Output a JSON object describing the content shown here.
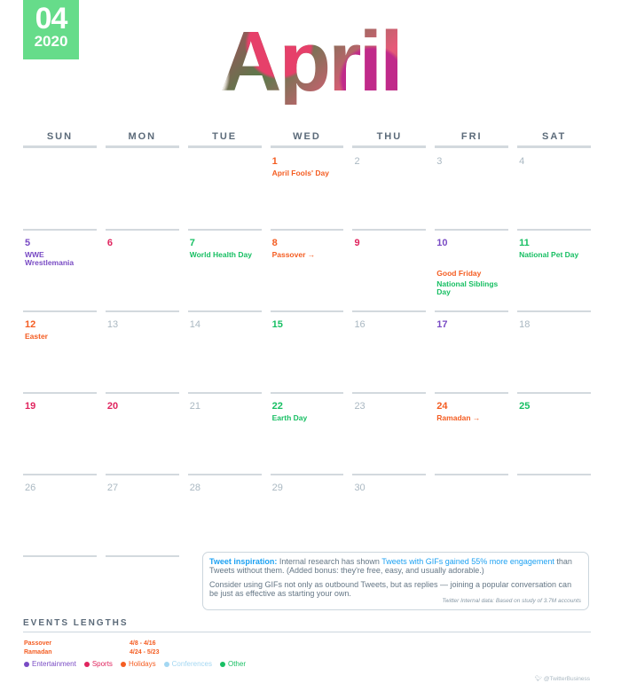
{
  "badge": {
    "month_number": "04",
    "year": "2020",
    "color": "#66dc8a"
  },
  "month_title": "April",
  "weekdays": [
    "SUN",
    "MON",
    "TUE",
    "WED",
    "THU",
    "FRI",
    "SAT"
  ],
  "weeks": [
    [
      {
        "num": "",
        "events": []
      },
      {
        "num": "",
        "events": []
      },
      {
        "num": "",
        "events": []
      },
      {
        "num": "1",
        "cat": "hol",
        "events": [
          {
            "label": "April Fools' Day",
            "cat": "hol"
          }
        ]
      },
      {
        "num": "2",
        "cat": "muted",
        "events": []
      },
      {
        "num": "3",
        "cat": "muted",
        "events": []
      },
      {
        "num": "4",
        "cat": "muted",
        "events": []
      }
    ],
    [
      {
        "num": "5",
        "cat": "ent",
        "events": [
          {
            "label": "WWE Wrestlemania",
            "cat": "ent"
          }
        ]
      },
      {
        "num": "6",
        "cat": "sport",
        "events": []
      },
      {
        "num": "7",
        "cat": "other",
        "events": [
          {
            "label": "World Health Day",
            "cat": "other"
          }
        ]
      },
      {
        "num": "8",
        "cat": "hol",
        "events": [
          {
            "label": "Passover →",
            "cat": "hol"
          }
        ]
      },
      {
        "num": "9",
        "cat": "sport",
        "events": []
      },
      {
        "num": "10",
        "cat": "ent",
        "events": [
          {
            "label": "Good Friday",
            "cat": "hol",
            "lower": true
          },
          {
            "label": "National Siblings Day",
            "cat": "other"
          }
        ]
      },
      {
        "num": "11",
        "cat": "other",
        "events": [
          {
            "label": "National Pet Day",
            "cat": "other"
          }
        ]
      }
    ],
    [
      {
        "num": "12",
        "cat": "hol",
        "events": [
          {
            "label": "Easter",
            "cat": "hol"
          }
        ]
      },
      {
        "num": "13",
        "cat": "muted",
        "events": []
      },
      {
        "num": "14",
        "cat": "muted",
        "events": []
      },
      {
        "num": "15",
        "cat": "other",
        "events": []
      },
      {
        "num": "16",
        "cat": "muted",
        "events": []
      },
      {
        "num": "17",
        "cat": "ent",
        "events": []
      },
      {
        "num": "18",
        "cat": "muted",
        "events": []
      }
    ],
    [
      {
        "num": "19",
        "cat": "sport",
        "events": []
      },
      {
        "num": "20",
        "cat": "sport",
        "events": []
      },
      {
        "num": "21",
        "cat": "muted",
        "events": []
      },
      {
        "num": "22",
        "cat": "other",
        "events": [
          {
            "label": "Earth Day",
            "cat": "other"
          }
        ]
      },
      {
        "num": "23",
        "cat": "muted",
        "events": []
      },
      {
        "num": "24",
        "cat": "hol",
        "events": [
          {
            "label": "Ramadan →",
            "cat": "hol"
          }
        ]
      },
      {
        "num": "25",
        "cat": "other",
        "events": []
      }
    ],
    [
      {
        "num": "26",
        "cat": "muted",
        "events": []
      },
      {
        "num": "27",
        "cat": "muted",
        "events": []
      },
      {
        "num": "28",
        "cat": "muted",
        "events": []
      },
      {
        "num": "29",
        "cat": "muted",
        "events": []
      },
      {
        "num": "30",
        "cat": "muted",
        "events": []
      },
      {
        "num": "",
        "events": []
      },
      {
        "num": "",
        "events": []
      }
    ]
  ],
  "tip": {
    "lead": "Tweet inspiration:",
    "text1": " Internal research has shown ",
    "highlight": "Tweets with GIFs gained 55% more engagement",
    "text2": " than Tweets without them. (Added bonus: they're free, easy, and usually adorable.)",
    "para2": "Consider using GIFs not only as outbound Tweets, but as replies — joining a popular conversation can be just as effective as starting your own.",
    "source": "Twitter Internal data: Based on study of 3.7M accounts"
  },
  "event_lengths": {
    "title": "EVENTS LENGTHS",
    "rows": [
      {
        "name": "Passover",
        "range": "4/8 - 4/16"
      },
      {
        "name": "Ramadan",
        "range": "4/24 - 5/23"
      }
    ]
  },
  "legend": [
    {
      "label": "Entertainment",
      "cat": "ent",
      "color": "#794bc4"
    },
    {
      "label": "Sports",
      "cat": "sport",
      "color": "#e0245e"
    },
    {
      "label": "Holidays",
      "cat": "hol",
      "color": "#f45d22"
    },
    {
      "label": "Conferences",
      "cat": "conf",
      "color": "#a3d7f2"
    },
    {
      "label": "Other",
      "cat": "other",
      "color": "#17bf63"
    }
  ],
  "footer": {
    "icon": "twitter-bird-icon",
    "handle": "@TwitterBusiness"
  }
}
